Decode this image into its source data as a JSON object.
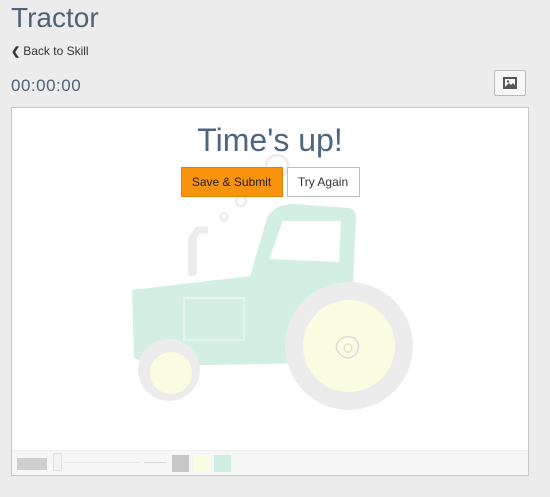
{
  "page": {
    "title": "Tractor"
  },
  "nav": {
    "back_label": "Back to Skill"
  },
  "timer": {
    "value": "00:00:00"
  },
  "icons": {
    "back": "chevron-left-icon",
    "image_toggle": "image-icon"
  },
  "overlay": {
    "heading": "Time's up!",
    "submit_label": "Save & Submit",
    "retry_label": "Try Again"
  },
  "colors": {
    "submit": "#f7930f",
    "tractor_green": "#d3efe4",
    "wheel_yellow": "#fbfde3",
    "wheel_grey": "#ececec"
  },
  "toolbar": {
    "swatches": [
      "#c7c7c7",
      "#fbfde3",
      "#cfeee0"
    ]
  }
}
